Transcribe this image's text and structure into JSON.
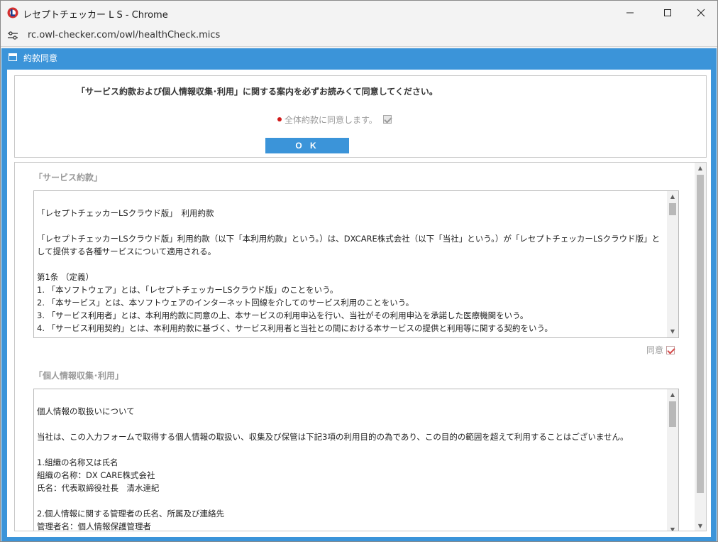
{
  "window": {
    "title": "レセプトチェッカー L S - Chrome",
    "url": "rc.owl-checker.com/owl/healthCheck.mics"
  },
  "dialog": {
    "title": "約款同意",
    "consent_message": "「サービス約款および個人情報収集･利用」に関する案内を必ずお読みくて同意してください。",
    "agree_all_label": "全体約款に同意します。",
    "agree_all_checked": true,
    "ok_label": "O K"
  },
  "sections": [
    {
      "title": "「サービス約款」",
      "agree_label": "同意",
      "agree_checked": true,
      "lines": [
        "「レセプトチェッカーLSクラウド版」　利用約款",
        "",
        "「レセプトチェッカーLSクラウド版」利用約款（以下「本利用約款」という。）は、DXCARE株式会社（以下「当社」という。）が「レセプトチェッカーLSクラウド版」として提供する各種サービスについて適用される。",
        "",
        "第1条 （定義）",
        "1. 「本ソフトウェア」とは、「レセプトチェッカーLSクラウド版」のことをいう。",
        "2. 「本サービス」とは、本ソフトウェアのインターネット回線を介してのサービス利用のことをいう。",
        "3. 「サービス利用者」とは、本利用約款に同意の上、本サービスの利用申込を行い、当社がその利用申込を承諾した医療機関をいう。",
        "4. 「サービス利用契約」とは、本利用約款に基づく、サービス利用者と当社との間における本サービスの提供と利用等に関する契約をいう。"
      ]
    },
    {
      "title": "「個人情報収集･利用」",
      "lines": [
        "個人情報の取扱いについて",
        "",
        "当社は、この入力フォームで取得する個人情報の取扱い、収集及び保管は下記3項の利用目的の為であり、この目的の範囲を超えて利用することはございません。",
        "",
        "1.組織の名称又は氏名",
        "組織の名称：DX CARE株式会社",
        "氏名：代表取締役社長　清水達紀",
        "",
        "2.個人情報に関する管理者の氏名、所属及び連絡先",
        "管理者名：個人情報保護管理者"
      ]
    }
  ]
}
